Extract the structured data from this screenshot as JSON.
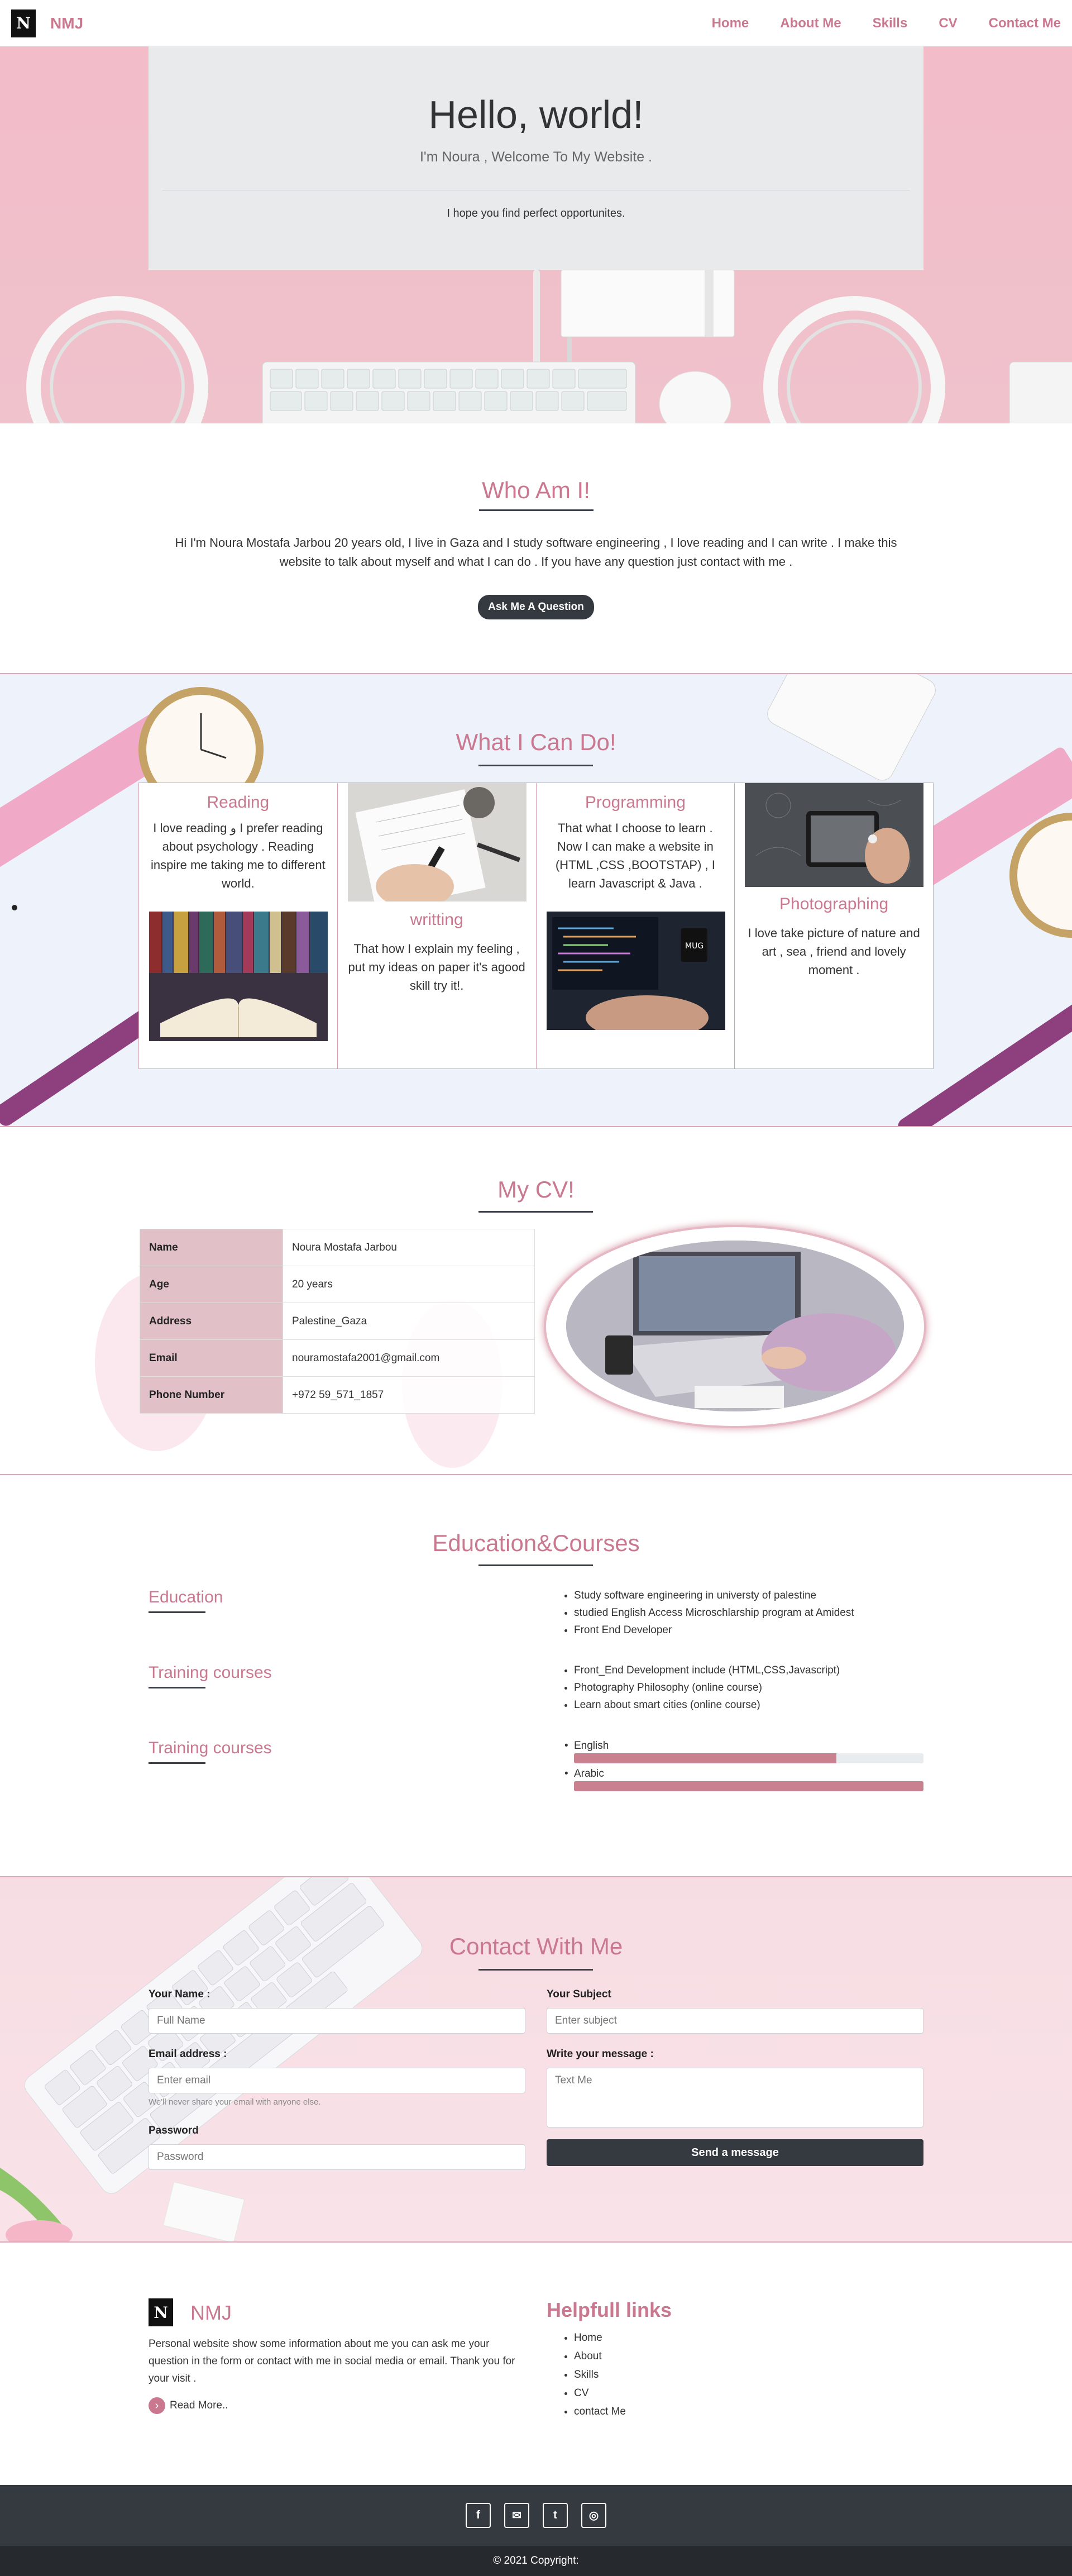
{
  "navbar": {
    "logo_letter": "N",
    "brand": "NMJ",
    "links": [
      "Home",
      "About Me",
      "Skills",
      "CV",
      "Contact Me"
    ]
  },
  "hero": {
    "title": "Hello, world!",
    "lead": "I'm Noura , Welcome To My Website .",
    "sub": "I hope you find perfect opportunites."
  },
  "about": {
    "title": "Who Am I!",
    "text": "Hi I'm Noura Mostafa Jarbou 20 years old, I live in Gaza and I study software engineering , I love reading and I can write . I make this website to talk about myself and what I can do . If you have any question just contact with me .",
    "button": "Ask Me A Question"
  },
  "skills": {
    "title": "What I Can Do!",
    "items": [
      {
        "title": "Reading",
        "text": "I love reading و I prefer reading about psychology . Reading inspire me taking me to different world."
      },
      {
        "title": "writting",
        "text": "That how I explain my feeling , put my ideas on paper it's agood skill try it!."
      },
      {
        "title": "Programming",
        "text": "That what I choose to learn . Now I can make a website in (HTML ,CSS ,BOOTSTAP) , I learn Javascript & Java ."
      },
      {
        "title": "Photographing",
        "text": "I love take picture of nature and art , sea , friend and lovely moment ."
      }
    ]
  },
  "cv": {
    "title": "My CV!",
    "rows": [
      {
        "key": "Name",
        "value": "Noura Mostafa Jarbou"
      },
      {
        "key": "Age",
        "value": "20 years"
      },
      {
        "key": "Address",
        "value": "Palestine_Gaza"
      },
      {
        "key": "Email",
        "value": "nouramostafa2001@gmail.com"
      },
      {
        "key": "Phone Number",
        "value": "+972 59_571_1857"
      }
    ]
  },
  "education": {
    "title": "Education&Courses",
    "groups": [
      {
        "label": "Education",
        "items": [
          "Study software engineering in universty of palestine",
          "studied English Access Microschlarship program at Amidest",
          "Front End Developer"
        ]
      },
      {
        "label": "Training courses",
        "items": [
          "Front_End Development include (HTML,CSS,Javascript)",
          "Photography Philosophy (online course)",
          "Learn about smart cities (online course)"
        ]
      },
      {
        "label": "Training courses",
        "items": []
      }
    ],
    "languages": [
      {
        "name": "English",
        "level": 0.75
      },
      {
        "name": "Arabic",
        "level": 1.0
      }
    ]
  },
  "contact": {
    "title": "Contact With Me",
    "name_label": "Your Name :",
    "name_placeholder": "Full Name",
    "email_label": "Email address :",
    "email_placeholder": "Enter email",
    "email_help": "We'll never share your email with anyone else.",
    "password_label": "Password",
    "password_placeholder": "Password",
    "subject_label": "Your Subject",
    "subject_placeholder": "Enter subject",
    "message_label": "Write your message :",
    "message_placeholder": "Text Me",
    "send": "Send a message"
  },
  "footer": {
    "logo_letter": "N",
    "brand": "NMJ",
    "desc": "Personal website show some information about me you can ask me your question in the form or contact with me in social media or email. Thank you for your visit .",
    "read_more": "Read More..",
    "help_title": "Helpfull links",
    "help_links": [
      "Home",
      "About",
      "Skills",
      "CV",
      "contact Me"
    ],
    "social": [
      {
        "icon": "facebook-icon",
        "glyph": "f"
      },
      {
        "icon": "envelope-icon",
        "glyph": "✉"
      },
      {
        "icon": "twitter-icon",
        "glyph": "t"
      },
      {
        "icon": "instagram-icon",
        "glyph": "◎"
      }
    ],
    "copyright": "© 2021 Copyright:"
  },
  "colors": {
    "accent": "#c9788f",
    "dark": "#343a40",
    "hero_bg": "#f2bcc8"
  }
}
